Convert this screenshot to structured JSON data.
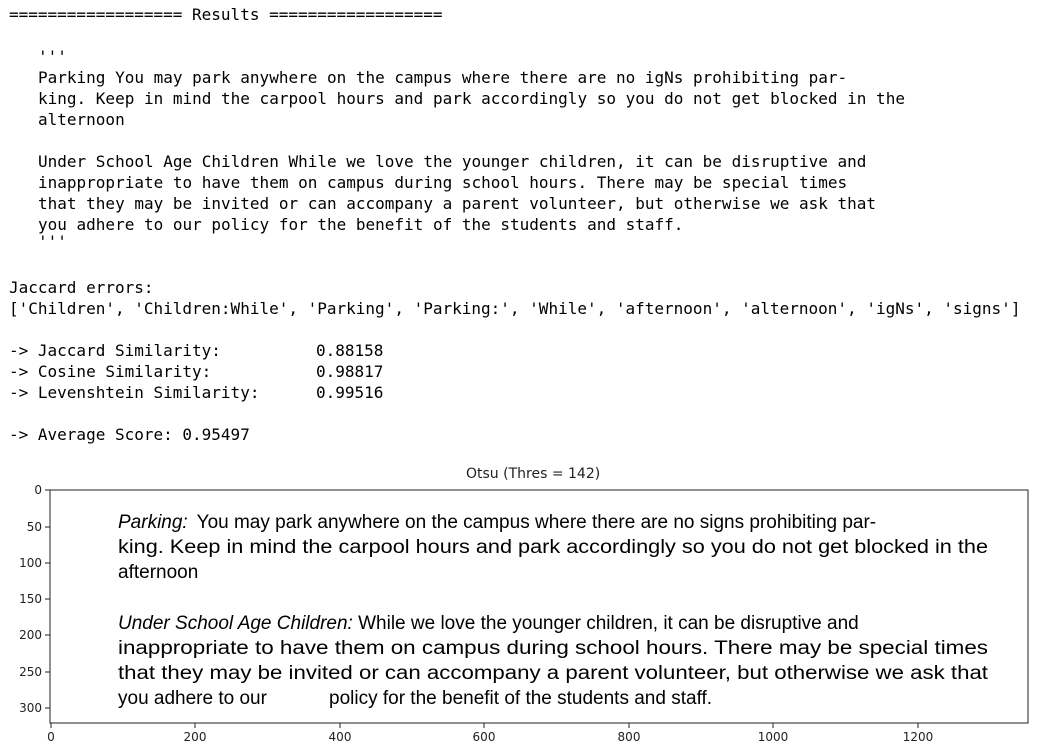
{
  "output": {
    "header": "================== Results ==================",
    "quote_open": "'''",
    "para1": [
      "Parking You may park anywhere on the campus where there are no igNs prohibiting par-",
      "king. Keep in mind the carpool hours and park accordingly so you do not get blocked in the",
      "alternoon"
    ],
    "para2": [
      "Under School Age Children While we love the younger children, it can be disruptive and",
      "inappropriate to have them on campus during school hours. There may be special times",
      "that they may be invited or can accompany a parent volunteer, but otherwise we ask that",
      "you adhere to our policy for the benefit of the students and staff."
    ],
    "quote_close": "'''",
    "jaccard_errors_label": "Jaccard errors:",
    "jaccard_errors_list": "['Children', 'Children:While', 'Parking', 'Parking:', 'While', 'afternoon', 'alternoon', 'igNs', 'signs']",
    "metrics": [
      {
        "label": "-> Jaccard Similarity:",
        "value": "0.88158"
      },
      {
        "label": "-> Cosine Similarity:",
        "value": "0.98817"
      },
      {
        "label": "-> Levenshtein Similarity:",
        "value": "0.99516"
      }
    ],
    "average": "-> Average Score: 0.95497"
  },
  "plot": {
    "title": "Otsu (Thres = 142)",
    "x_ticks": [
      "0",
      "200",
      "400",
      "600",
      "800",
      "1000",
      "1200"
    ],
    "y_ticks": [
      "0",
      "50",
      "100",
      "150",
      "200",
      "250",
      "300"
    ],
    "image_text": {
      "p1_l1_italic": "Parking:",
      "p1_l1_rest": "You may park anywhere on the campus where there are no signs prohibiting par-",
      "p1_l2": "king. Keep in mind the carpool hours and park accordingly so you do not get blocked in the",
      "p1_l3": "afternoon",
      "p2_l1_italic": "Under School Age Children:",
      "p2_l1_rest": "While we love the younger children, it can be disruptive and",
      "p2_l2": "inappropriate to have them on campus during school hours. There may be special times",
      "p2_l3": "that they may be invited or can accompany a parent volunteer, but otherwise we ask that",
      "p2_l4_a": "you adhere to our",
      "p2_l4_b": "policy for the benefit of the students and staff."
    }
  }
}
